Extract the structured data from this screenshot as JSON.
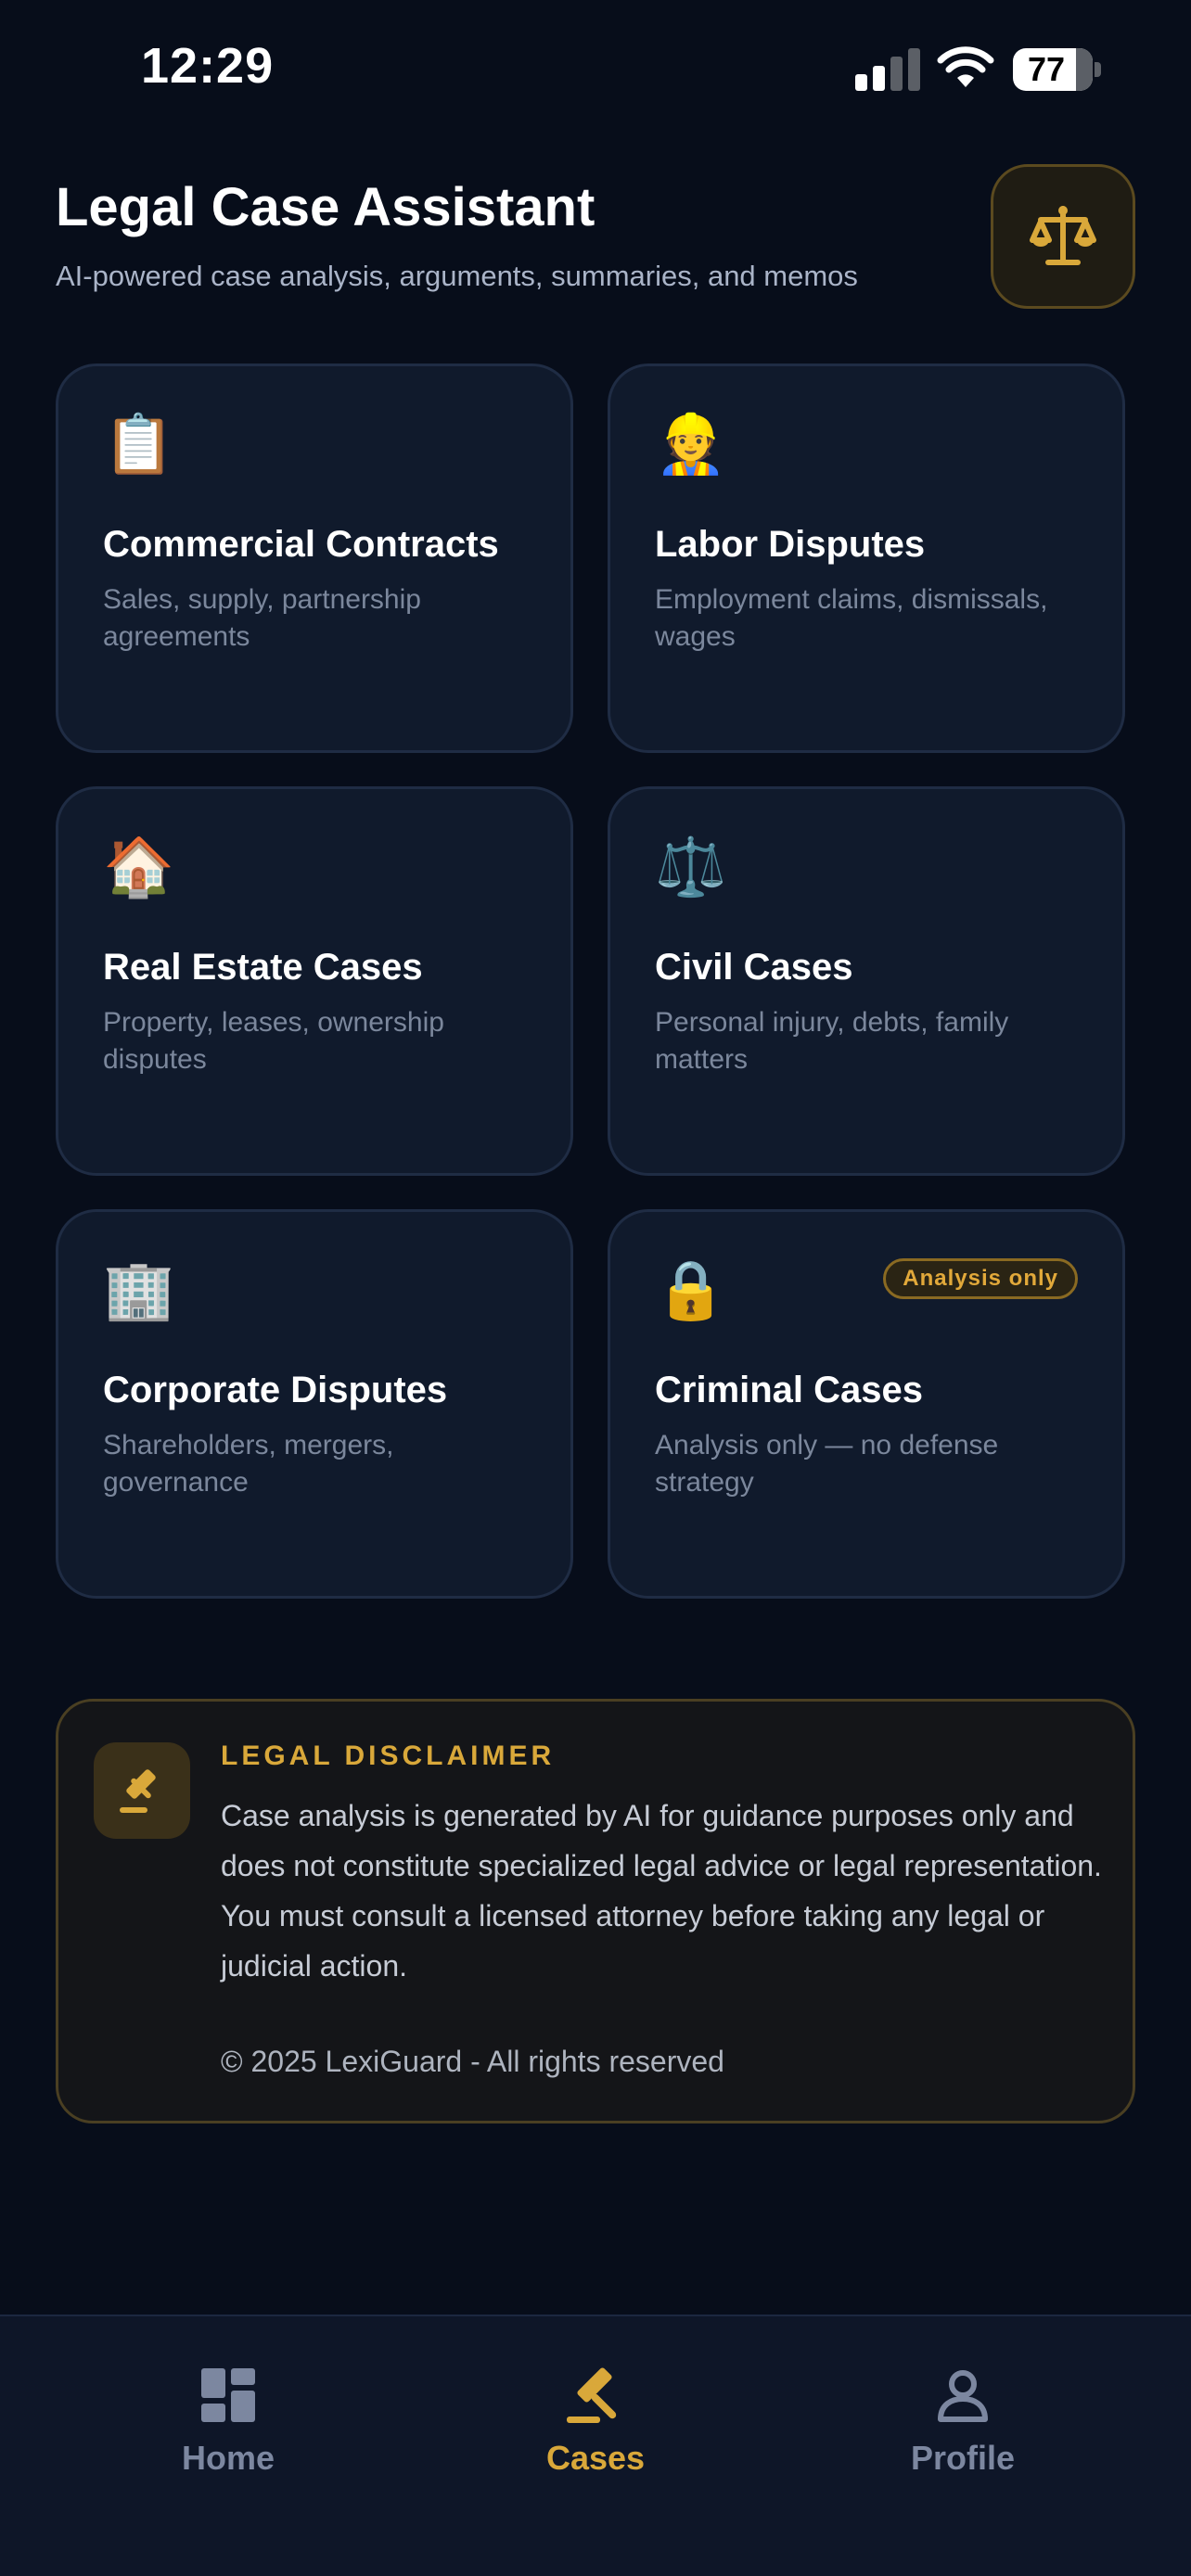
{
  "status_bar": {
    "time": "12:29",
    "battery": "77"
  },
  "header": {
    "title": "Legal Case Assistant",
    "subtitle": "AI-powered case analysis, arguments, summaries, and memos",
    "badge_icon": "scales-icon"
  },
  "categories": [
    {
      "icon": "clipboard-icon",
      "glyph": "📋",
      "title": "Commercial Contracts",
      "description": "Sales, supply, partnership agreements"
    },
    {
      "icon": "worker-icon",
      "glyph": "👷",
      "title": "Labor Disputes",
      "description": "Employment claims, dismissals, wages"
    },
    {
      "icon": "house-icon",
      "glyph": "🏠",
      "title": "Real Estate Cases",
      "description": "Property, leases, ownership disputes"
    },
    {
      "icon": "scales-icon",
      "glyph": "⚖️",
      "title": "Civil Cases",
      "description": "Personal injury, debts, family matters"
    },
    {
      "icon": "office-building-icon",
      "glyph": "🏢",
      "title": "Corporate Disputes",
      "description": "Shareholders, mergers, governance"
    },
    {
      "icon": "lock-icon",
      "glyph": "🔒",
      "title": "Criminal Cases",
      "description": "Analysis only — no defense strategy",
      "badge": "Analysis only"
    }
  ],
  "disclaimer": {
    "icon": "gavel-icon",
    "heading": "LEGAL DISCLAIMER",
    "text": "Case analysis is generated by AI for guidance purposes only and does not constitute specialized legal advice or legal representation. You must consult a licensed attorney before taking any legal or judicial action.",
    "copyright": "© 2025 LexiGuard - All rights reserved"
  },
  "tab_bar": {
    "active_tab": "Cases",
    "tabs": [
      {
        "label": "Home",
        "icon": "dashboard-icon"
      },
      {
        "label": "Cases",
        "icon": "gavel-icon"
      },
      {
        "label": "Profile",
        "icon": "person-icon"
      }
    ]
  },
  "colors": {
    "background": "#070d1a",
    "card": "#101a2c",
    "accent_gold": "#d9a83a",
    "inactive_tab": "#7c87a0"
  }
}
